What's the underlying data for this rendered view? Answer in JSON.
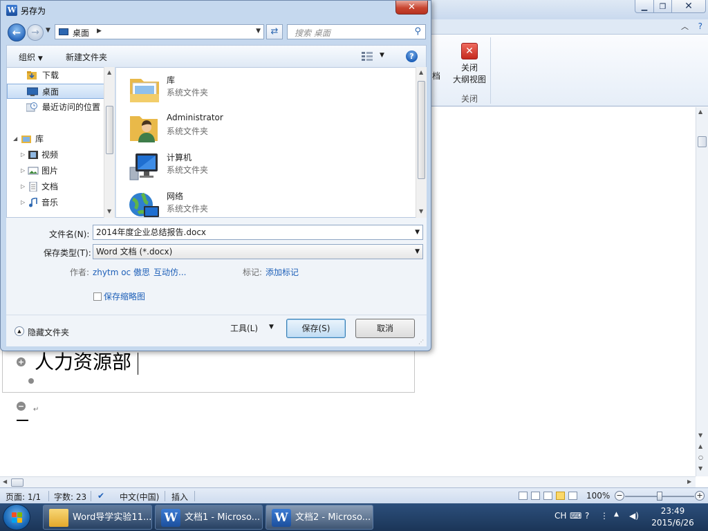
{
  "ribbon": {
    "partial_label": "档",
    "close_outline_line1": "关闭",
    "close_outline_line2": "大纲视图",
    "group_label": "关闭"
  },
  "document": {
    "heading": "人力资源部"
  },
  "statusbar": {
    "page": "页面: 1/1",
    "words": "字数: 23",
    "language": "中文(中国)",
    "mode": "插入",
    "zoom": "100%"
  },
  "taskbar": {
    "items": [
      {
        "label": "Word导学实验11..."
      },
      {
        "label": "文档1 - Microso..."
      },
      {
        "label": "文档2 - Microso..."
      }
    ],
    "tray_lang": "CH",
    "time": "23:49",
    "date": "2015/6/26"
  },
  "dialog": {
    "title": "另存为",
    "address": "桌面",
    "search_placeholder": "搜索 桌面",
    "toolbar": {
      "organize": "组织",
      "new_folder": "新建文件夹"
    },
    "nav_items": [
      {
        "label": "下载"
      },
      {
        "label": "桌面"
      },
      {
        "label": "最近访问的位置"
      },
      {
        "label": "库"
      },
      {
        "label": "视频"
      },
      {
        "label": "图片"
      },
      {
        "label": "文档"
      },
      {
        "label": "音乐"
      }
    ],
    "files": [
      {
        "name": "库",
        "type": "系统文件夹"
      },
      {
        "name": "Administrator",
        "type": "系统文件夹"
      },
      {
        "name": "计算机",
        "type": "系统文件夹"
      },
      {
        "name": "网络",
        "type": "系统文件夹"
      }
    ],
    "form": {
      "filename_label": "文件名(N):",
      "filename_value": "2014年度企业总结报告.docx",
      "type_label": "保存类型(T):",
      "type_value": "Word 文档 (*.docx)",
      "author_label": "作者:",
      "author_value": "zhytm oc 傲思",
      "author_more": "互动仿...",
      "tags_label": "标记:",
      "tags_value": "添加标记",
      "thumbnail_label": "保存缩略图"
    },
    "bottom": {
      "hide_folders": "隐藏文件夹",
      "tools": "工具(L)",
      "save": "保存(S)",
      "cancel": "取消"
    }
  },
  "colors": {
    "accent_blue": "#1d5fb8",
    "taskbar": "#1b3557",
    "dialog_frame": "#c5d8ee"
  }
}
